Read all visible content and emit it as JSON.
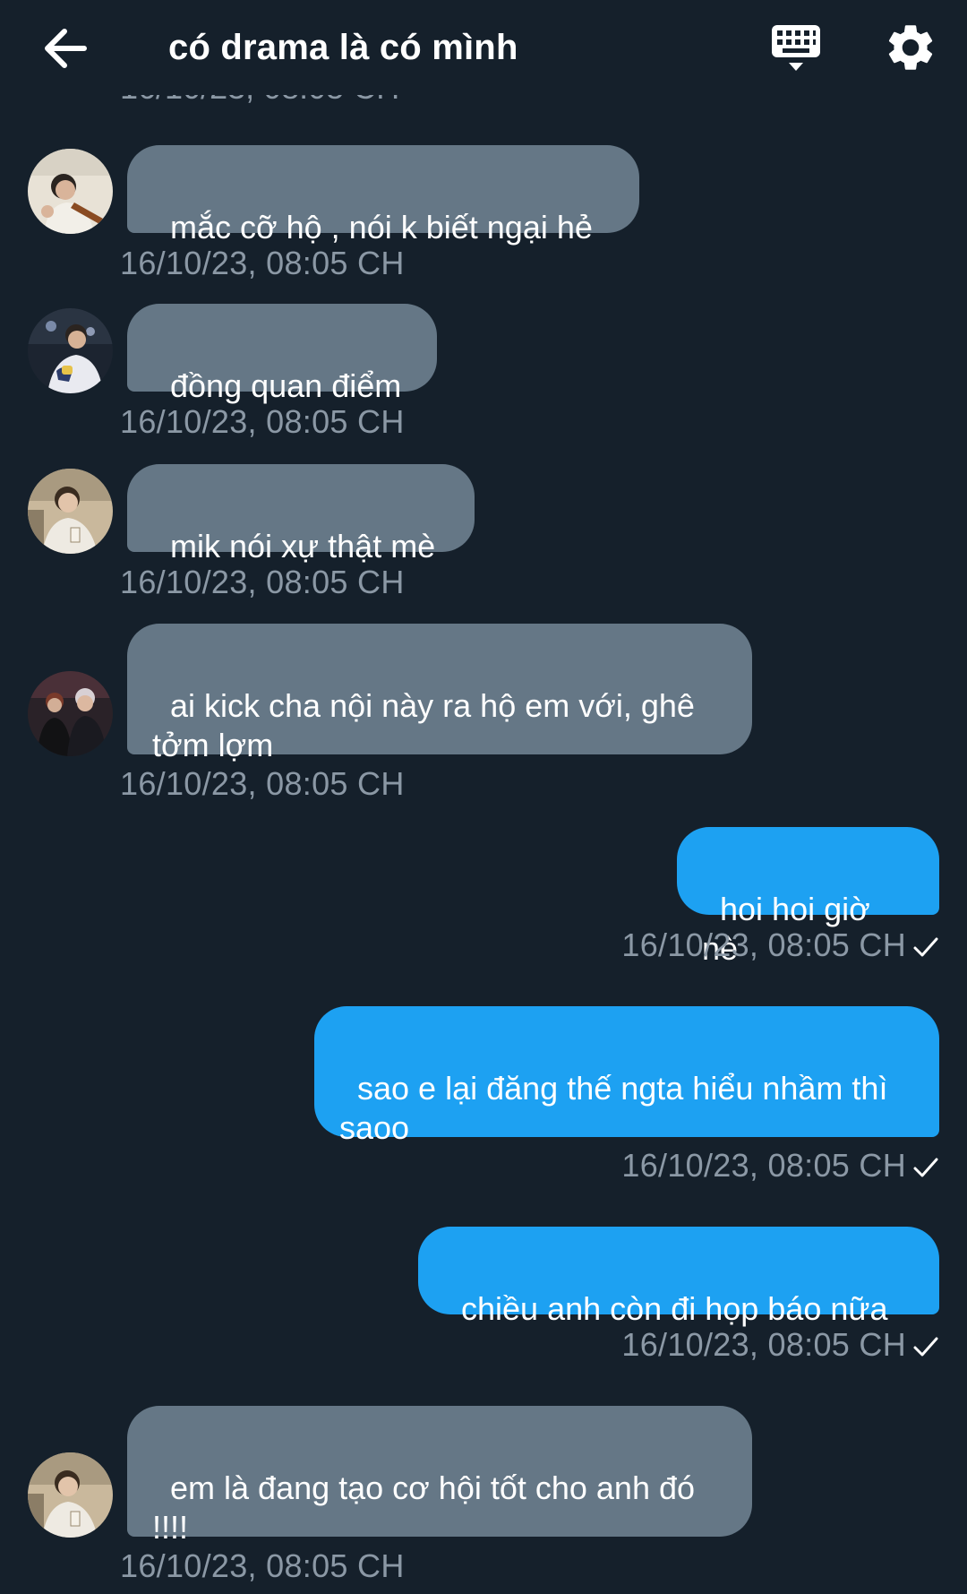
{
  "header": {
    "title": "có drama là có mình",
    "back_icon": "arrow-left-icon",
    "keyboard_icon": "keyboard-icon",
    "settings_icon": "gear-icon"
  },
  "messages": [
    {
      "direction": "in",
      "text": "mắc cỡ hộ , nói k biết ngại hẻ",
      "time": "16/10/23, 08:05 CH"
    },
    {
      "direction": "in",
      "text": "đồng quan điểm",
      "time": "16/10/23, 08:05 CH"
    },
    {
      "direction": "in",
      "text": "mik nói xự thật mè",
      "time": "16/10/23, 08:05 CH"
    },
    {
      "direction": "in",
      "text": "ai kick cha nội này ra hộ em với, ghê tởm lợm",
      "time": "16/10/23, 08:05 CH"
    },
    {
      "direction": "out",
      "text": "hoi hoi giờ nè",
      "time": "16/10/23, 08:05 CH"
    },
    {
      "direction": "out",
      "text": "sao e lại đăng thế ngta hiểu nhầm thì saoo",
      "time": "16/10/23, 08:05 CH"
    },
    {
      "direction": "out",
      "text": "chiều anh còn đi họp báo nữa",
      "time": "16/10/23, 08:05 CH"
    },
    {
      "direction": "in",
      "text": "em là đang tạo cơ hội tốt cho anh đó !!!!",
      "time": "16/10/23, 08:05 CH"
    }
  ],
  "colors": {
    "background": "#15202b",
    "incoming_bubble": "#657786",
    "outgoing_bubble": "#1da1f2",
    "timestamp": "#8b98a5"
  }
}
